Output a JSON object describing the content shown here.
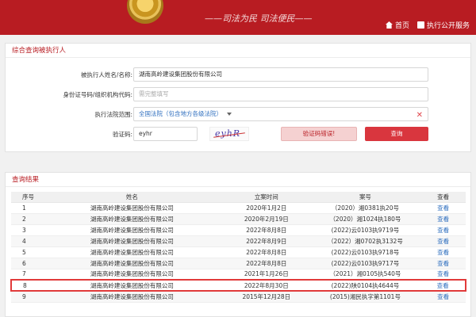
{
  "header": {
    "title": "",
    "slogan": "——司法为民  司法便民——",
    "nav": [
      {
        "icon": "home-icon",
        "label": "首页"
      },
      {
        "icon": "document-icon",
        "label": "执行公开服务"
      }
    ]
  },
  "search_panel": {
    "title": "综合查询被执行人",
    "name_label": "被执行人姓名/名称:",
    "name_value": "湖南高岭建设集团股份有限公司",
    "id_label": "身份证号码/组织机构代码:",
    "id_placeholder": "需完整填写",
    "court_label": "执行法院范围:",
    "court_value": "全国法院（包含地方各级法院）",
    "captcha_label": "验证码:",
    "captcha_value": "eyhr",
    "captcha_image_text": "eyhR",
    "error_button": "验证码错误!",
    "query_button": "查询"
  },
  "results_panel": {
    "title": "查询结果",
    "columns": [
      "序号",
      "姓名",
      "立案时间",
      "案号",
      "查看"
    ],
    "rows": [
      {
        "no": "1",
        "name": "湖南高岭建设集团股份有限公司",
        "date": "2020年1月2日",
        "case": "（2020）湘0381执20号",
        "view": "查看"
      },
      {
        "no": "2",
        "name": "湖南高岭建设集团股份有限公司",
        "date": "2020年2月19日",
        "case": "（2020）湘1024执180号",
        "view": "查看"
      },
      {
        "no": "3",
        "name": "湖南高岭建设集团股份有限公司",
        "date": "2022年8月8日",
        "case": "(2022)云0103执9719号",
        "view": "查看"
      },
      {
        "no": "4",
        "name": "湖南高岭建设集团股份有限公司",
        "date": "2022年8月9日",
        "case": "（2022）湘0702执3132号",
        "view": "查看"
      },
      {
        "no": "5",
        "name": "湖南高岭建设集团股份有限公司",
        "date": "2022年8月8日",
        "case": "(2022)云0103执9718号",
        "view": "查看"
      },
      {
        "no": "6",
        "name": "湖南高岭建设集团股份有限公司",
        "date": "2022年8月8日",
        "case": "(2022)云0103执9717号",
        "view": "查看"
      },
      {
        "no": "7",
        "name": "湖南高岭建设集团股份有限公司",
        "date": "2021年1月26日",
        "case": "（2021）湘0105执540号",
        "view": "查看"
      },
      {
        "no": "8",
        "name": "湖南高岭建设集团股份有限公司",
        "date": "2022年8月30日",
        "case": "(2022)陕0104执4644号",
        "view": "查看"
      },
      {
        "no": "9",
        "name": "湖南高岭建设集团股份有限公司",
        "date": "2015年12月28日",
        "case": "(2015)湘民执字第1101号",
        "view": "查看"
      }
    ]
  },
  "colors": {
    "accent": "#b81c22",
    "link": "#2f6fbf",
    "highlight": "#e13a3a"
  }
}
